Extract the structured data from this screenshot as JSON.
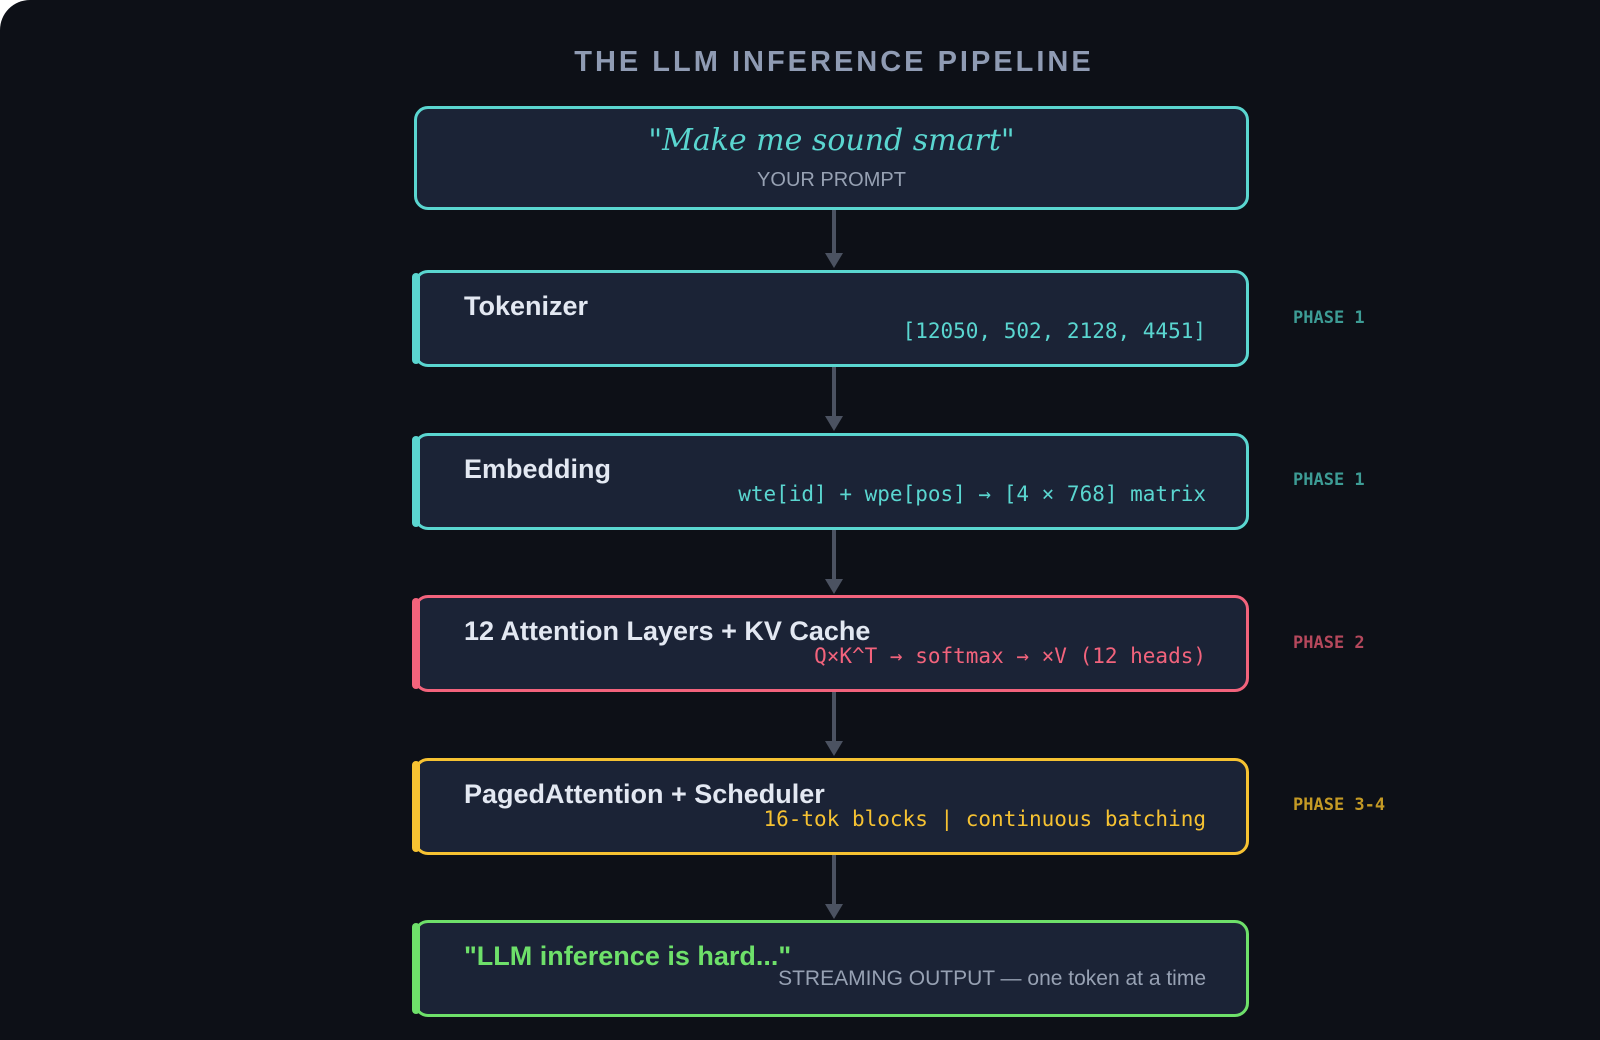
{
  "title": "THE LLM INFERENCE PIPELINE",
  "prompt": {
    "text": "\"Make me sound smart\"",
    "label": "YOUR PROMPT"
  },
  "stages": [
    {
      "title": "Tokenizer",
      "detail": "[12050, 502, 2128, 4451]",
      "phase": "PHASE 1",
      "color": "#5ad6d0",
      "phase_color": "#3d9c95"
    },
    {
      "title": "Embedding",
      "detail": "wte[id] + wpe[pos] → [4 × 768] matrix",
      "phase": "PHASE 1",
      "color": "#5ad6d0",
      "phase_color": "#3d9c95"
    },
    {
      "title": "12 Attention Layers + KV Cache",
      "detail": "Q×K^T → softmax → ×V (12 heads)",
      "phase": "PHASE 2",
      "color": "#f2637c",
      "phase_color": "#b5485c"
    },
    {
      "title": "PagedAttention + Scheduler",
      "detail": "16-tok blocks | continuous batching",
      "phase": "PHASE 3-4",
      "color": "#f6c232",
      "phase_color": "#c49a25"
    }
  ],
  "output": {
    "title": "\"LLM inference is hard...\"",
    "detail": "STREAMING OUTPUT — one token at a time",
    "color": "#6ee06a"
  },
  "colors": {
    "background": "#0d1017",
    "box_fill": "#1b2336",
    "connector": "#4b5261",
    "prompt_border": "#5ad6d0"
  }
}
